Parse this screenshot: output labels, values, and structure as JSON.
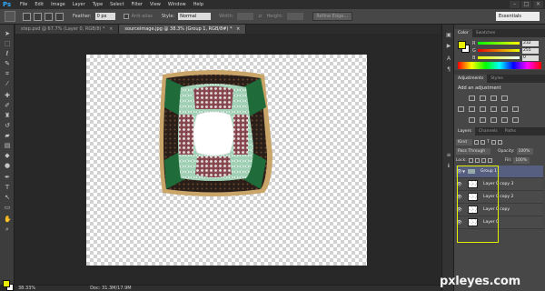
{
  "app": {
    "logo": "Ps"
  },
  "menu": [
    "File",
    "Edit",
    "Image",
    "Layer",
    "Type",
    "Select",
    "Filter",
    "View",
    "Window",
    "Help"
  ],
  "window_controls": [
    "–",
    "□",
    "×"
  ],
  "options": {
    "feather_label": "Feather:",
    "feather_value": "0 px",
    "antialias_label": "Anti-alias",
    "style_label": "Style:",
    "style_value": "Normal",
    "width_label": "Width:",
    "height_label": "Height:",
    "refine_edge": "Refine Edge..."
  },
  "workspace": "Essentials",
  "tabs": [
    {
      "label": "step.psd @ 67.7% (Layer 0, RGB/8) *",
      "close": "×"
    },
    {
      "label": "sourceimage.jpg @ 38.3% (Group 1, RGB/8#) *",
      "close": "×"
    }
  ],
  "status": {
    "zoom": "38.33%",
    "doc": "Doc: 31.3M/17.9M"
  },
  "colors": {
    "foreground": "#e8f000",
    "background": "#ffffff",
    "highlight": "#e0f000"
  },
  "color_panel": {
    "tabs": [
      "Color",
      "Swatches"
    ],
    "channels": [
      {
        "label": "R",
        "value": "232"
      },
      {
        "label": "G",
        "value": "255"
      },
      {
        "label": "B",
        "value": "0"
      }
    ]
  },
  "adjustments_panel": {
    "tabs": [
      "Adjustments",
      "Styles"
    ],
    "title": "Add an adjustment"
  },
  "layers_panel": {
    "tabs": [
      "Layers",
      "Channels",
      "Paths"
    ],
    "kind_label": "Kind",
    "blend_mode": "Pass Through",
    "opacity_label": "Opacity:",
    "opacity_value": "100%",
    "lock_label": "Lock:",
    "fill_label": "Fill:",
    "fill_value": "100%",
    "layers": [
      {
        "name": "Group 1",
        "type": "group",
        "selected": true
      },
      {
        "name": "Layer 0 copy 3",
        "type": "layer"
      },
      {
        "name": "Layer 0 copy 2",
        "type": "layer"
      },
      {
        "name": "Layer 0 copy",
        "type": "layer"
      },
      {
        "name": "Layer 0",
        "type": "layer"
      }
    ]
  },
  "watermark": {
    "text": "pxleyes",
    "suffix": ".com"
  }
}
